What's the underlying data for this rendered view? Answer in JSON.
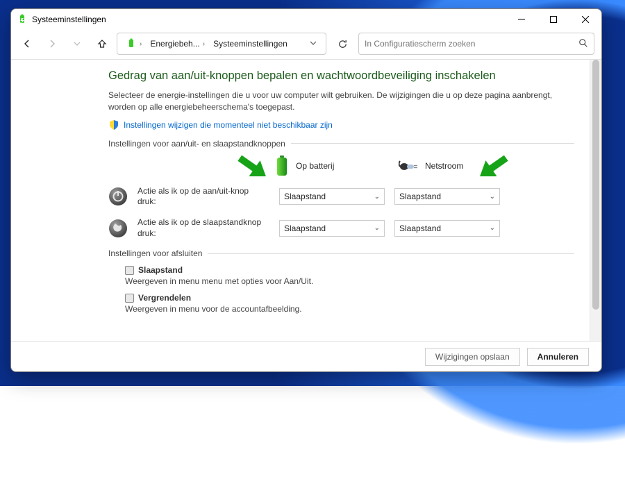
{
  "window": {
    "title": "Systeeminstellingen",
    "min_tooltip": "Minimaliseren",
    "max_tooltip": "Maximaliseren",
    "close_tooltip": "Sluiten"
  },
  "nav": {
    "crumb1": "Energiebeh...",
    "crumb2": "Systeeminstellingen",
    "search_placeholder": "In Configuratiescherm zoeken"
  },
  "heading": "Gedrag van aan/uit-knoppen bepalen en wachtwoordbeveiliging inschakelen",
  "desc": "Selecteer de energie-instellingen die u voor uw computer wilt gebruiken. De wijzigingen die u op deze pagina aanbrengt, worden op alle energiebeheerschema's toegepast.",
  "shield_link": "Instellingen wijzigen die momenteel niet beschikbaar zijn",
  "section_buttons_legend": "Instellingen voor aan/uit- en slaapstandknoppen",
  "mode_battery": "Op batterij",
  "mode_ac": "Netstroom",
  "row_power": {
    "label": "Actie als ik op de aan/uit-knop druk:",
    "battery_value": "Slaapstand",
    "ac_value": "Slaapstand"
  },
  "row_sleep": {
    "label": "Actie als ik op de slaapstandknop druk:",
    "battery_value": "Slaapstand",
    "ac_value": "Slaapstand"
  },
  "section_shutdown_legend": "Instellingen voor afsluiten",
  "shutdown": {
    "item1_name": "Slaapstand",
    "item1_sub": "Weergeven in menu menu met opties voor Aan/Uit.",
    "item2_name": "Vergrendelen",
    "item2_sub": "Weergeven in menu voor de accountafbeelding."
  },
  "buttons": {
    "save": "Wijzigingen opslaan",
    "cancel": "Annuleren"
  }
}
